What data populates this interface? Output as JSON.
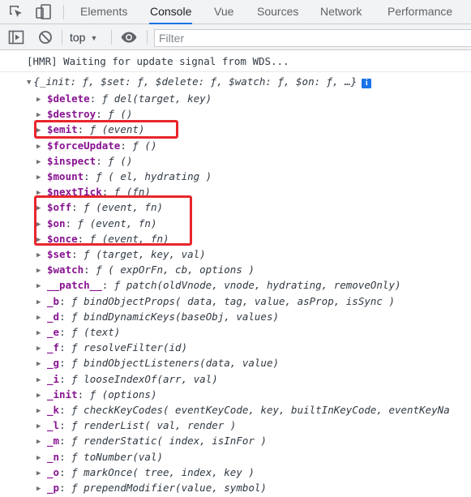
{
  "devtools": {
    "tabs": [
      {
        "label": "Elements"
      },
      {
        "label": "Console",
        "active": true
      },
      {
        "label": "Vue"
      },
      {
        "label": "Sources"
      },
      {
        "label": "Network"
      },
      {
        "label": "Performance"
      }
    ]
  },
  "toolbar": {
    "context": "top",
    "filter_placeholder": "Filter"
  },
  "console": {
    "hmr_message": "[HMR] Waiting for update signal from WDS...",
    "object_summary": "{_init: ƒ, $set: ƒ, $delete: ƒ, $watch: ƒ, $on: ƒ, …}",
    "properties": [
      {
        "key": "$delete",
        "value": "ƒ del(target, key)"
      },
      {
        "key": "$destroy",
        "value": "ƒ ()"
      },
      {
        "key": "$emit",
        "value": "ƒ (event)"
      },
      {
        "key": "$forceUpdate",
        "value": "ƒ ()"
      },
      {
        "key": "$inspect",
        "value": "ƒ ()"
      },
      {
        "key": "$mount",
        "value": "ƒ ( el, hydrating )"
      },
      {
        "key": "$nextTick",
        "value": "ƒ (fn)"
      },
      {
        "key": "$off",
        "value": "ƒ (event, fn)"
      },
      {
        "key": "$on",
        "value": "ƒ (event, fn)"
      },
      {
        "key": "$once",
        "value": "ƒ (event, fn)"
      },
      {
        "key": "$set",
        "value": "ƒ (target, key, val)"
      },
      {
        "key": "$watch",
        "value": "ƒ ( expOrFn, cb, options )"
      },
      {
        "key": "__patch__",
        "value": "ƒ patch(oldVnode, vnode, hydrating, removeOnly)"
      },
      {
        "key": "_b",
        "value": "ƒ bindObjectProps( data, tag, value, asProp, isSync )"
      },
      {
        "key": "_d",
        "value": "ƒ bindDynamicKeys(baseObj, values)"
      },
      {
        "key": "_e",
        "value": "ƒ (text)"
      },
      {
        "key": "_f",
        "value": "ƒ resolveFilter(id)"
      },
      {
        "key": "_g",
        "value": "ƒ bindObjectListeners(data, value)"
      },
      {
        "key": "_i",
        "value": "ƒ looseIndexOf(arr, val)"
      },
      {
        "key": "_init",
        "value": "ƒ (options)"
      },
      {
        "key": "_k",
        "value": "ƒ checkKeyCodes( eventKeyCode, key, builtInKeyCode, eventKeyNa"
      },
      {
        "key": "_l",
        "value": "ƒ renderList( val, render )"
      },
      {
        "key": "_m",
        "value": "ƒ renderStatic( index, isInFor )"
      },
      {
        "key": "_n",
        "value": "ƒ toNumber(val)"
      },
      {
        "key": "_o",
        "value": "ƒ markOnce( tree, index, key )"
      },
      {
        "key": "_p",
        "value": "ƒ prependModifier(value, symbol)"
      }
    ]
  },
  "colors": {
    "highlight": "#e8262b",
    "property_key": "#881391",
    "active_tab": "#1a73e8"
  }
}
